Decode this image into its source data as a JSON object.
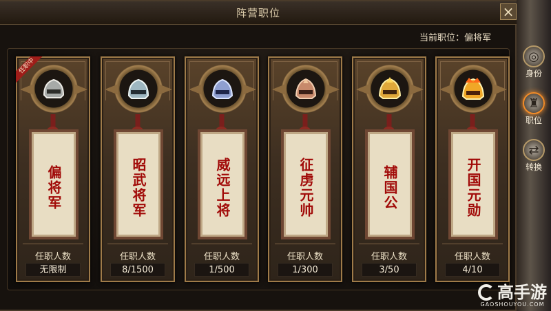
{
  "title": "阵营职位",
  "current": "当前职位：偏将军",
  "close_icon": "close-icon",
  "badge": "任职中",
  "cards": [
    {
      "name": "偏将军",
      "count_label": "任职人数",
      "count": "无限制",
      "helmet": "silver-helmet-icon"
    },
    {
      "name": "昭武将军",
      "count_label": "任职人数",
      "count": "8/1500",
      "helmet": "steel-helmet-icon"
    },
    {
      "name": "威远上将",
      "count_label": "任职人数",
      "count": "1/500",
      "helmet": "blue-helmet-icon"
    },
    {
      "name": "征虏元帅",
      "count_label": "任职人数",
      "count": "1/300",
      "helmet": "bronze-helmet-icon"
    },
    {
      "name": "辅国公",
      "count_label": "任职人数",
      "count": "3/50",
      "helmet": "gold-helmet-icon"
    },
    {
      "name": "开国元勋",
      "count_label": "任职人数",
      "count": "4/10",
      "helmet": "crowned-helmet-icon"
    }
  ],
  "sidebar": [
    {
      "label": "身份",
      "icon": "identity-icon"
    },
    {
      "label": "职位",
      "icon": "position-icon"
    },
    {
      "label": "转换",
      "icon": "switch-icon"
    }
  ],
  "logo": {
    "cn": "高手游",
    "en": "GAOSHOUYOU.COM"
  }
}
